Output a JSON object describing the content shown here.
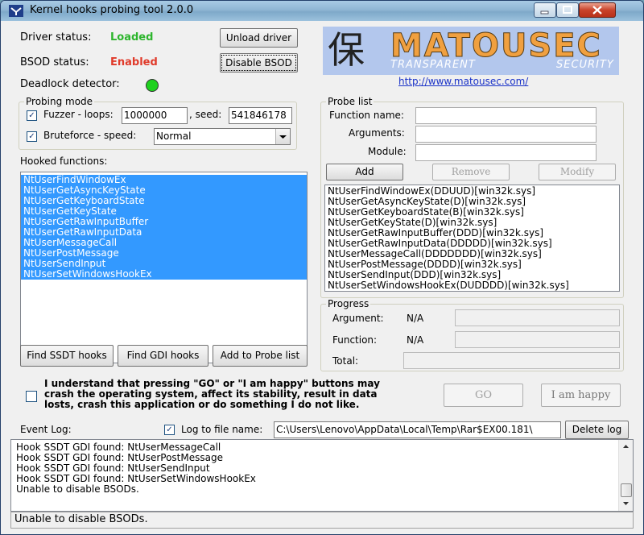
{
  "window": {
    "title": "Kernel hooks probing tool 2.0.0"
  },
  "status": {
    "driver_label": "Driver status:",
    "driver_value": "Loaded",
    "bsod_label": "BSOD status:",
    "bsod_value": "Enabled",
    "deadlock_label": "Deadlock detector:",
    "unload_driver": "Unload driver",
    "disable_bsod": "Disable BSOD"
  },
  "logo": {
    "kanji": "保",
    "brand": "MATOUSEC",
    "tagline_left": "TRANSPARENT",
    "tagline_right": "SECURITY",
    "url": "http://www.matousec.com/"
  },
  "probing_mode": {
    "legend": "Probing mode",
    "fuzzer_label": "Fuzzer - loops:",
    "loops": "1000000",
    "seed_label": ", seed:",
    "seed": "541846178",
    "bruteforce_label": "Bruteforce - speed:",
    "speed": "Normal"
  },
  "hooked": {
    "label": "Hooked functions:",
    "items": [
      "NtUserFindWindowEx",
      "NtUserGetAsyncKeyState",
      "NtUserGetKeyboardState",
      "NtUserGetKeyState",
      "NtUserGetRawInputBuffer",
      "NtUserGetRawInputData",
      "NtUserMessageCall",
      "NtUserPostMessage",
      "NtUserSendInput",
      "NtUserSetWindowsHookEx"
    ],
    "find_ssdt": "Find SSDT hooks",
    "find_gdi": "Find GDI hooks",
    "add_to_probe": "Add to Probe list"
  },
  "probe_list": {
    "legend": "Probe list",
    "function_label": "Function name:",
    "arguments_label": "Arguments:",
    "module_label": "Module:",
    "add": "Add",
    "remove": "Remove",
    "modify": "Modify",
    "items": [
      "NtUserFindWindowEx(DDUUD)[win32k.sys]",
      "NtUserGetAsyncKeyState(D)[win32k.sys]",
      "NtUserGetKeyboardState(B)[win32k.sys]",
      "NtUserGetKeyState(D)[win32k.sys]",
      "NtUserGetRawInputBuffer(DDD)[win32k.sys]",
      "NtUserGetRawInputData(DDDDD)[win32k.sys]",
      "NtUserMessageCall(DDDDDDD)[win32k.sys]",
      "NtUserPostMessage(DDDD)[win32k.sys]",
      "NtUserSendInput(DDD)[win32k.sys]",
      "NtUserSetWindowsHookEx(DUDDDD)[win32k.sys]"
    ]
  },
  "progress": {
    "legend": "Progress",
    "argument_label": "Argument:",
    "argument_value": "N/A",
    "function_label": "Function:",
    "function_value": "N/A",
    "total_label": "Total:"
  },
  "warning": {
    "line1": "I understand that pressing \"GO\" or \"I am happy\" buttons may",
    "line2": "crash the operating system, affect its  stability, result in data",
    "line3": "losts, crash this application or do something I do not like.",
    "go": "GO",
    "happy": "I am happy"
  },
  "log": {
    "label": "Event Log:",
    "to_file_label": "Log to file name:",
    "file_path": "C:\\Users\\Lenovo\\AppData\\Local\\Temp\\Rar$EX00.181\\",
    "delete": "Delete log",
    "lines": [
      "Hook SSDT GDI found: NtUserMessageCall",
      "Hook SSDT GDI found: NtUserPostMessage",
      "Hook SSDT GDI found: NtUserSendInput",
      "Hook SSDT GDI found: NtUserSetWindowsHookEx",
      "Unable to disable BSODs."
    ]
  },
  "statusbar": {
    "text": "Unable to disable BSODs."
  },
  "colors": {
    "loaded": "#2db52d",
    "enabled": "#e03a2a",
    "selection": "#3399ff",
    "led": "#1fd11f"
  }
}
